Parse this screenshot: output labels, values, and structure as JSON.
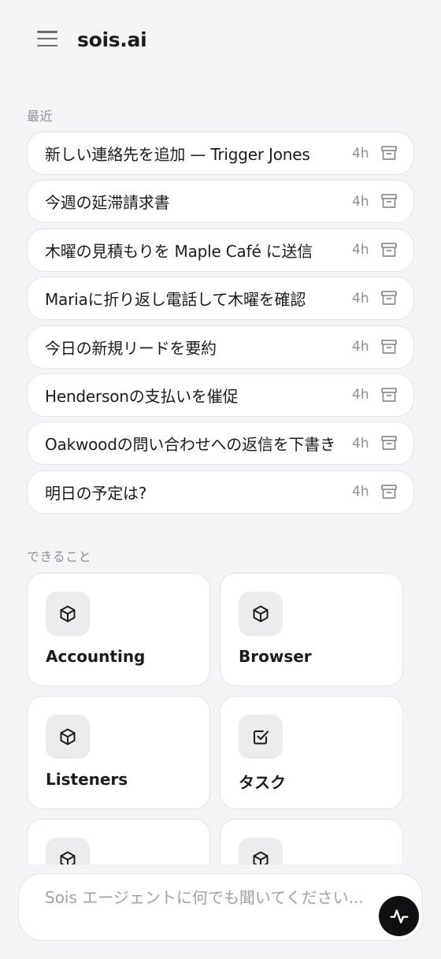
{
  "header": {
    "title": "sois.ai",
    "menu_icon": "hamburger-menu-icon"
  },
  "recent": {
    "label": "最近",
    "items": [
      {
        "title": "新しい連絡先を追加 — Trigger Jones",
        "time": "4h"
      },
      {
        "title": "今週の延滞請求書",
        "time": "4h"
      },
      {
        "title": "木曜の見積もりを Maple Café に送信",
        "time": "4h"
      },
      {
        "title": "Mariaに折り返し電話して木曜を確認",
        "time": "4h"
      },
      {
        "title": "今日の新規リードを要約",
        "time": "4h"
      },
      {
        "title": "Hendersonの支払いを催促",
        "time": "4h"
      },
      {
        "title": "Oakwoodの問い合わせへの返信を下書き",
        "time": "4h"
      },
      {
        "title": "明日の予定は?",
        "time": "4h"
      }
    ]
  },
  "capabilities": {
    "label": "できること",
    "cards": [
      {
        "label": "Accounting",
        "icon": "cube-icon"
      },
      {
        "label": "Browser",
        "icon": "cube-icon"
      },
      {
        "label": "Listeners",
        "icon": "cube-icon"
      },
      {
        "label": "タスク",
        "icon": "checkbox-icon"
      },
      {
        "label": "",
        "icon": "cube-icon"
      },
      {
        "label": "",
        "icon": "cube-icon"
      }
    ]
  },
  "composer": {
    "placeholder": "Sois エージェントに何でも聞いてください...",
    "send_icon": "activity-pulse-icon"
  },
  "colors": {
    "background": "#f5f5f7",
    "card": "#ffffff",
    "border": "#e3e3e8",
    "muted": "#8e8e93",
    "button": "#111113"
  }
}
